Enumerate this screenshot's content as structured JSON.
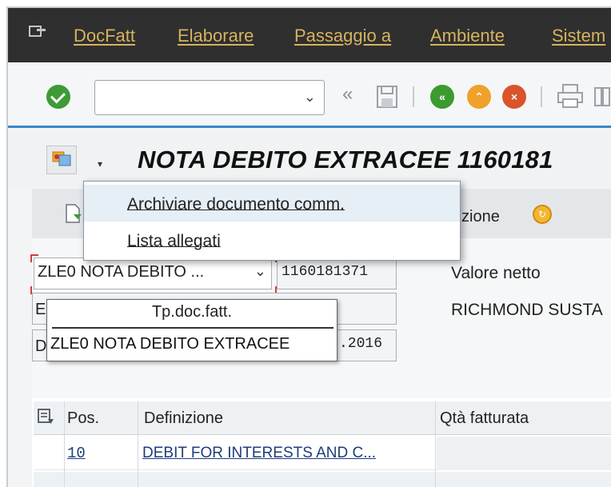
{
  "menubar": {
    "items": [
      "DocFatt",
      "Elaborare",
      "Passaggio a",
      "Ambiente",
      "Sistem"
    ]
  },
  "toolbar": {
    "command_value": "",
    "icons": [
      "ok-icon",
      "back-double-icon",
      "save-icon",
      "back-green-icon",
      "exit-yellow-icon",
      "cancel-red-icon",
      "print-icon"
    ]
  },
  "title": {
    "text": "NOTA DEBITO EXTRACEE 1160181"
  },
  "services_menu": {
    "items": [
      {
        "label": "Archiviare documento comm.",
        "highlighted": true
      },
      {
        "label": "Lista allegati",
        "highlighted": false
      }
    ]
  },
  "app_toolbar": {
    "partial_label": "zione"
  },
  "form": {
    "doc_type_value": "ZLE0 NOTA DEBITO ...",
    "doc_number": "1160181371",
    "net_value_label": "Valore netto",
    "payer_text": "RICHMOND SUSTA",
    "row2_label_fragment": "E",
    "row3_label_fragment": "D",
    "date_fragment": ".2016"
  },
  "tooltip": {
    "heading": "Tp.doc.fatt.",
    "body": "ZLE0 NOTA DEBITO EXTRACEE"
  },
  "table": {
    "headers": [
      "Pos.",
      "Definizione",
      "Qtà fatturata"
    ],
    "rows": [
      {
        "pos": "10",
        "definition": "DEBIT FOR INTERESTS  AND C...",
        "qty": ""
      }
    ]
  },
  "colors": {
    "menubar_bg": "#2f2f2f",
    "menubar_text": "#d6b35d",
    "accent_line": "#3a86c8",
    "ok_green": "#3c9b36"
  }
}
